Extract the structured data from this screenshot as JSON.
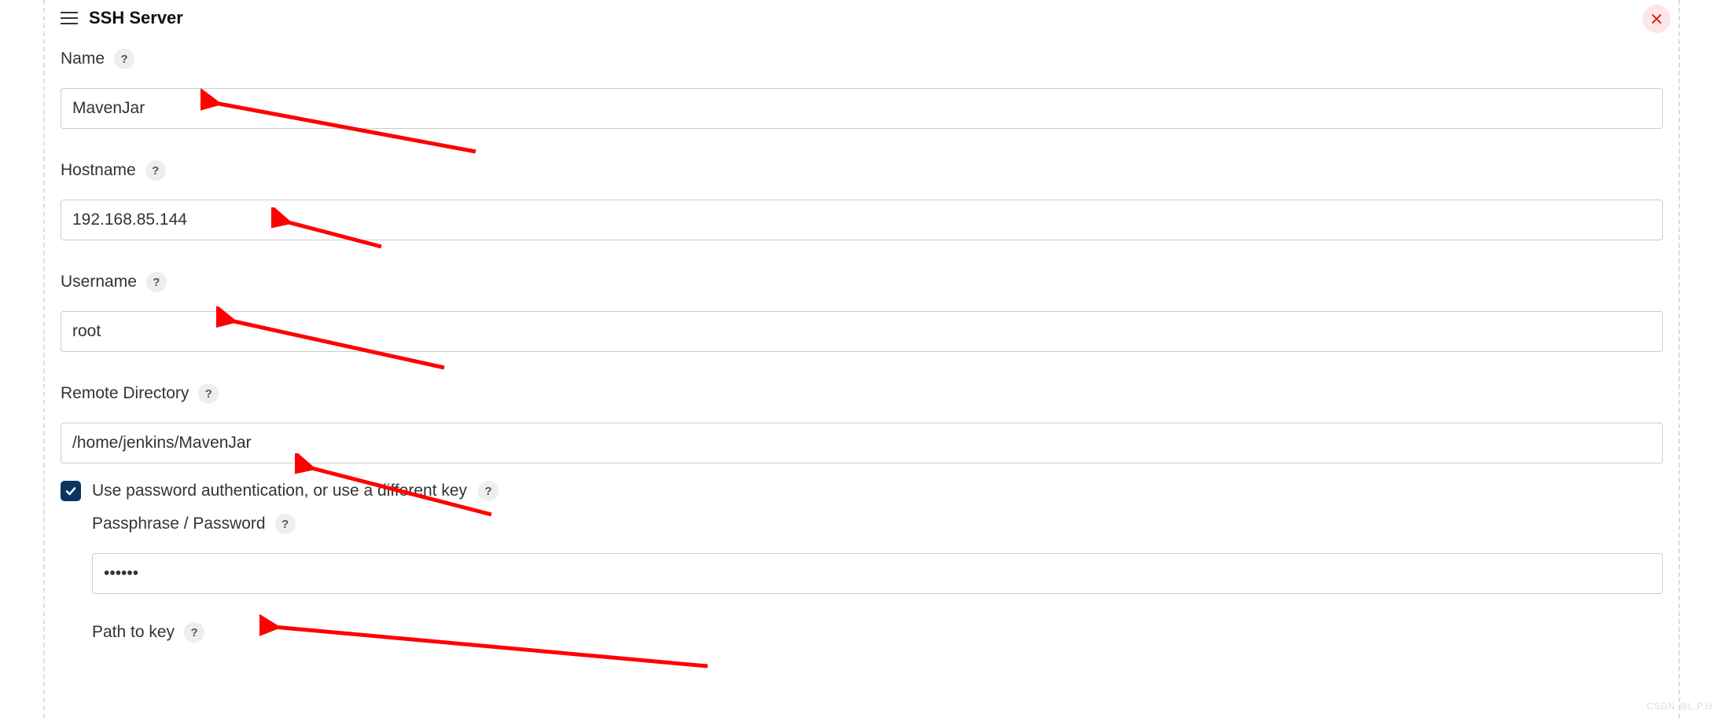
{
  "section": {
    "title": "SSH Server"
  },
  "fields": {
    "name": {
      "label": "Name",
      "value": "MavenJar"
    },
    "hostname": {
      "label": "Hostname",
      "value": "192.168.85.144"
    },
    "username": {
      "label": "Username",
      "value": "root"
    },
    "remoteDirectory": {
      "label": "Remote Directory",
      "value": "/home/jenkins/MavenJar"
    },
    "passphrase": {
      "label": "Passphrase / Password",
      "value": "••••••"
    },
    "pathToKey": {
      "label": "Path to key",
      "value": ""
    }
  },
  "checkbox": {
    "usePasswordAuth": {
      "label": "Use password authentication, or use a different key",
      "checked": true
    }
  },
  "help_glyph": "?",
  "watermark": "CSDN @L.P.H"
}
